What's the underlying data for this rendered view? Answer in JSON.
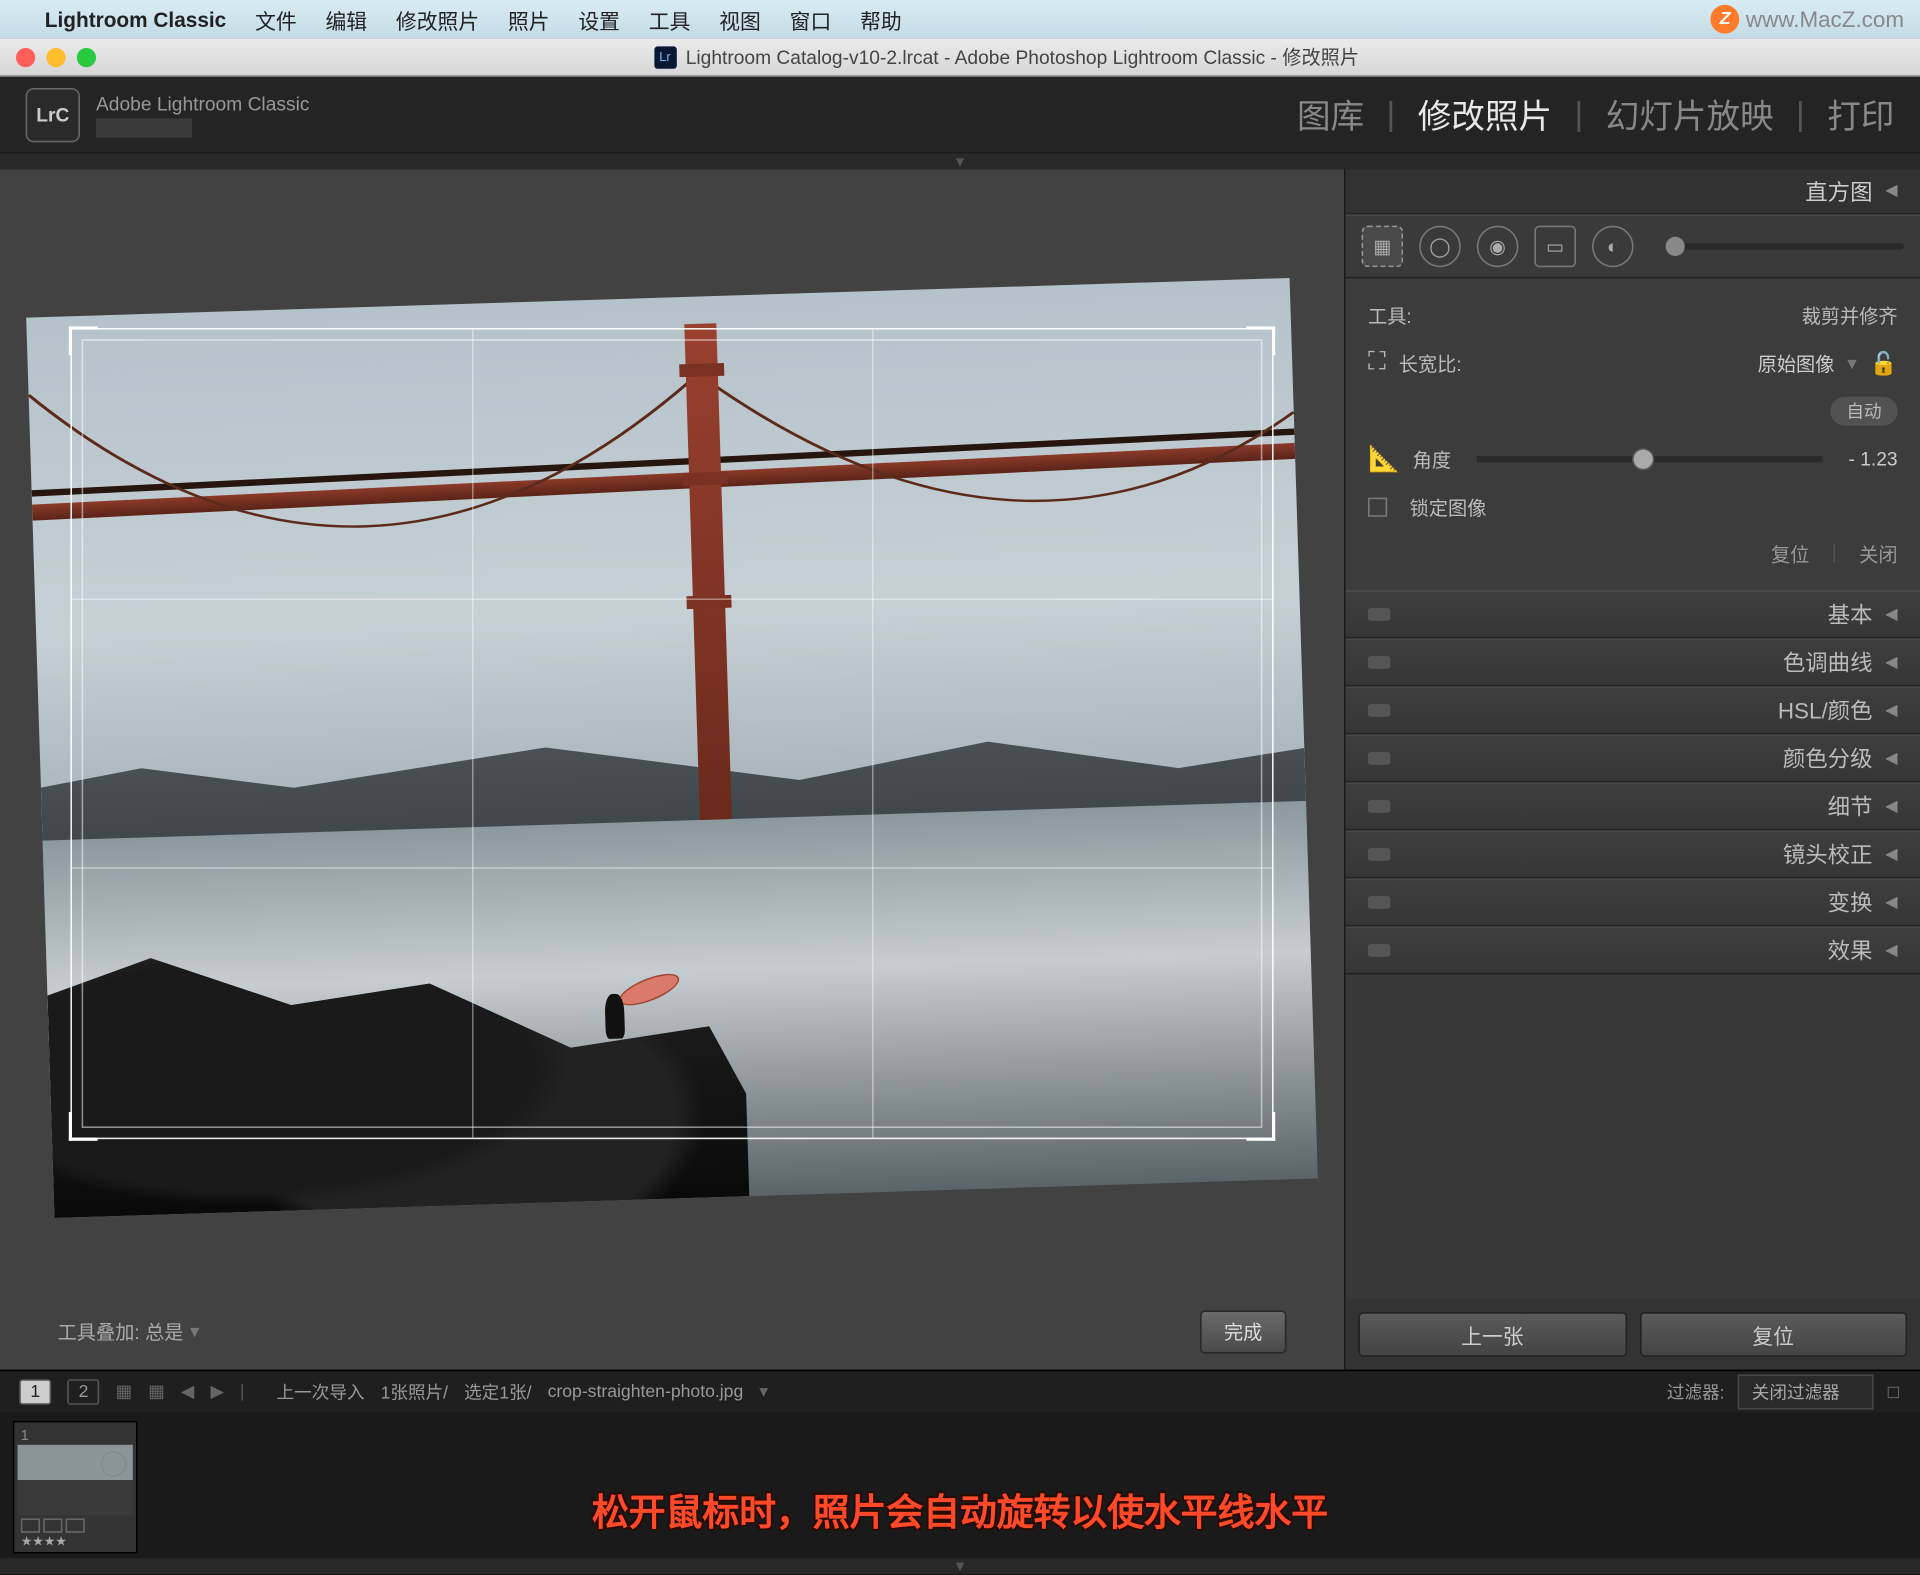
{
  "menubar": {
    "app_name": "Lightroom Classic",
    "items": [
      "文件",
      "编辑",
      "修改照片",
      "照片",
      "设置",
      "工具",
      "视图",
      "窗口",
      "帮助"
    ],
    "watermark": "www.MacZ.com"
  },
  "titlebar": {
    "title": "Lightroom Catalog-v10-2.lrcat - Adobe Photoshop Lightroom Classic - 修改照片"
  },
  "header": {
    "logo": "LrC",
    "identity": "Adobe Lightroom Classic",
    "modules": [
      "图库",
      "修改照片",
      "幻灯片放映",
      "打印"
    ],
    "active_module": "修改照片"
  },
  "canvas": {
    "toolbar_label": "工具叠加:",
    "toolbar_value": "总是",
    "done_label": "完成"
  },
  "right": {
    "histogram": "直方图",
    "tool_label": "工具:",
    "tool_name": "裁剪并修齐",
    "aspect_label": "长宽比:",
    "aspect_value": "原始图像",
    "auto_label": "自动",
    "angle_label": "角度",
    "angle_value": "- 1.23",
    "lock_label": "锁定图像",
    "reset": "复位",
    "close": "关闭",
    "sections": [
      "基本",
      "色调曲线",
      "HSL/颜色",
      "颜色分级",
      "细节",
      "镜头校正",
      "变换",
      "效果"
    ],
    "prev_btn": "上一张",
    "reset_btn": "复位"
  },
  "secondary": {
    "display1": "1",
    "display2": "2",
    "breadcrumb": "上一次导入",
    "count": "1张照片/",
    "selected": "选定1张/",
    "filename": "crop-straighten-photo.jpg",
    "filter_label": "过滤器:",
    "filter_value": "关闭过滤器"
  },
  "filmstrip": {
    "thumb_index": "1",
    "stars": "★★★★"
  },
  "caption": "松开鼠标时，照片会自动旋转以使水平线水平"
}
